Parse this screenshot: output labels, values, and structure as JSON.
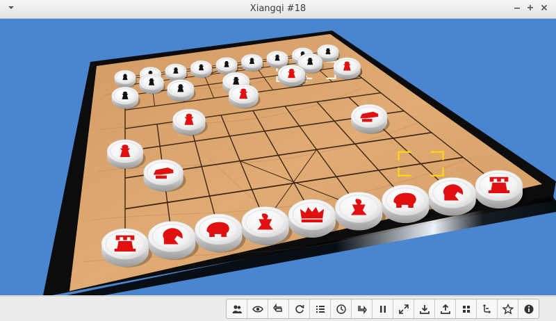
{
  "window": {
    "title": "Xiangqi #18",
    "menu_icon": "chevron-down-icon",
    "minimize_icon": "minimize-icon",
    "maximize_icon": "maximize-icon",
    "close_icon": "close-icon"
  },
  "colors": {
    "background": "#4a86d0",
    "board_wood": "#d9a46d",
    "board_frame": "#111111",
    "red_piece": "#e01010",
    "black_piece": "#111111",
    "piece_body": "#f4f4f4",
    "highlight": "#ffd21a"
  },
  "board": {
    "files": 9,
    "ranks": 10
  },
  "toolbar": {
    "buttons": [
      {
        "name": "players-button",
        "icon": "players-icon"
      },
      {
        "name": "view-button",
        "icon": "eye-icon"
      },
      {
        "name": "undo-button",
        "icon": "undo-icon"
      },
      {
        "name": "restart-button",
        "icon": "restart-icon"
      },
      {
        "name": "move-list-button",
        "icon": "list-icon"
      },
      {
        "name": "clock-button",
        "icon": "clock-icon"
      },
      {
        "name": "redo-button",
        "icon": "redo-icon"
      },
      {
        "name": "pause-button",
        "icon": "pause-icon"
      },
      {
        "name": "fullscreen-button",
        "icon": "fullscreen-icon"
      },
      {
        "name": "load-button",
        "icon": "download-icon"
      },
      {
        "name": "save-button",
        "icon": "upload-icon"
      },
      {
        "name": "apps-button",
        "icon": "grid-icon"
      },
      {
        "name": "hint-button",
        "icon": "hint-icon"
      },
      {
        "name": "favorite-button",
        "icon": "star-icon"
      },
      {
        "name": "about-button",
        "icon": "info-icon"
      }
    ]
  }
}
